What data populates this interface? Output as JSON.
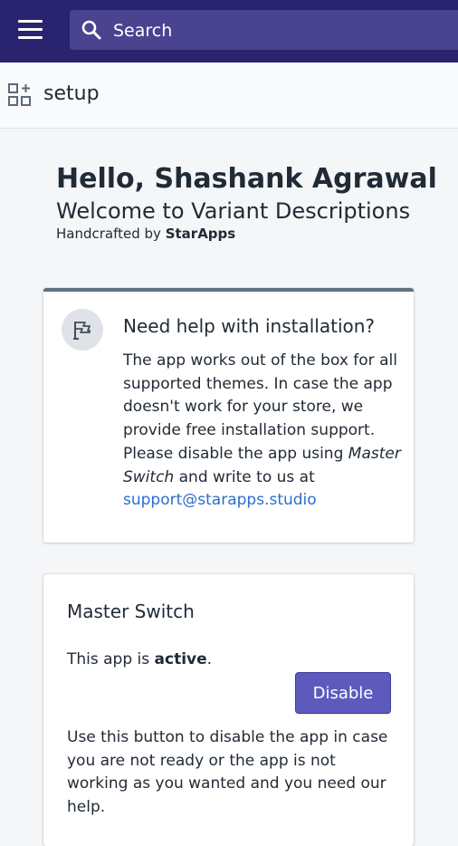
{
  "topbar": {
    "search_placeholder": "Search"
  },
  "subheader": {
    "title": "setup"
  },
  "welcome": {
    "greeting": "Hello, Shashank Agrawal",
    "subtitle": "Welcome to Variant Descriptions",
    "handcrafted_prefix": "Handcrafted by ",
    "brand": "StarApps"
  },
  "help_card": {
    "title": "Need help with installation?",
    "body_part1": "The app works out of the box for all supported themes. In case the app doesn't work for your store, we provide free installation support. Please disable the app using ",
    "body_italic": "Master Switch",
    "body_part2": " and write to us at ",
    "email": "support@starapps.studio"
  },
  "master_card": {
    "title": "Master Switch",
    "status_prefix": "This app is ",
    "status_value": "active",
    "status_suffix": ".",
    "button_label": "Disable",
    "help_text": "Use this button to disable the app in case you are not ready or the app is not working as you wanted and you need our help."
  },
  "colors": {
    "topbar": "#2a2470",
    "search_bg": "#4a4390",
    "accent_button": "#5c5bbd",
    "link": "#2c6ecb",
    "card_top_border": "#5e7282"
  },
  "icons": [
    "hamburger-icon",
    "search-icon",
    "apps-icon",
    "flag-icon"
  ]
}
